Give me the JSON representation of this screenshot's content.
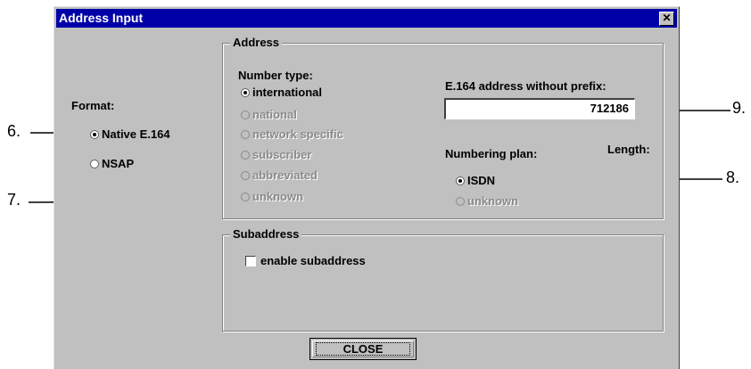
{
  "window": {
    "title": "Address Input",
    "close_glyph": "✕"
  },
  "format": {
    "label": "Format:",
    "options": [
      {
        "label": "Native E.164",
        "checked": true
      },
      {
        "label": "NSAP",
        "checked": false
      }
    ]
  },
  "address": {
    "group_label": "Address",
    "number_type": {
      "label": "Number type:",
      "options": [
        {
          "label": "international",
          "checked": true,
          "enabled": true
        },
        {
          "label": "national",
          "checked": false,
          "enabled": false
        },
        {
          "label": "network specific",
          "checked": false,
          "enabled": false
        },
        {
          "label": "subscriber",
          "checked": false,
          "enabled": false
        },
        {
          "label": "abbreviated",
          "checked": false,
          "enabled": false
        },
        {
          "label": "unknown",
          "checked": false,
          "enabled": false
        }
      ]
    },
    "e164": {
      "label": "E.164 address without prefix:",
      "value": "712186"
    },
    "numbering_plan": {
      "label": "Numbering plan:",
      "options": [
        {
          "label": "ISDN",
          "checked": true,
          "enabled": true
        },
        {
          "label": "unknown",
          "checked": false,
          "enabled": false
        }
      ]
    },
    "length_label": "Length:"
  },
  "subaddress": {
    "group_label": "Subaddress",
    "enable_label": "enable subaddress",
    "enabled": false
  },
  "close_button": {
    "label": "CLOSE"
  },
  "callouts": [
    "6.",
    "7.",
    "8.",
    "9."
  ]
}
